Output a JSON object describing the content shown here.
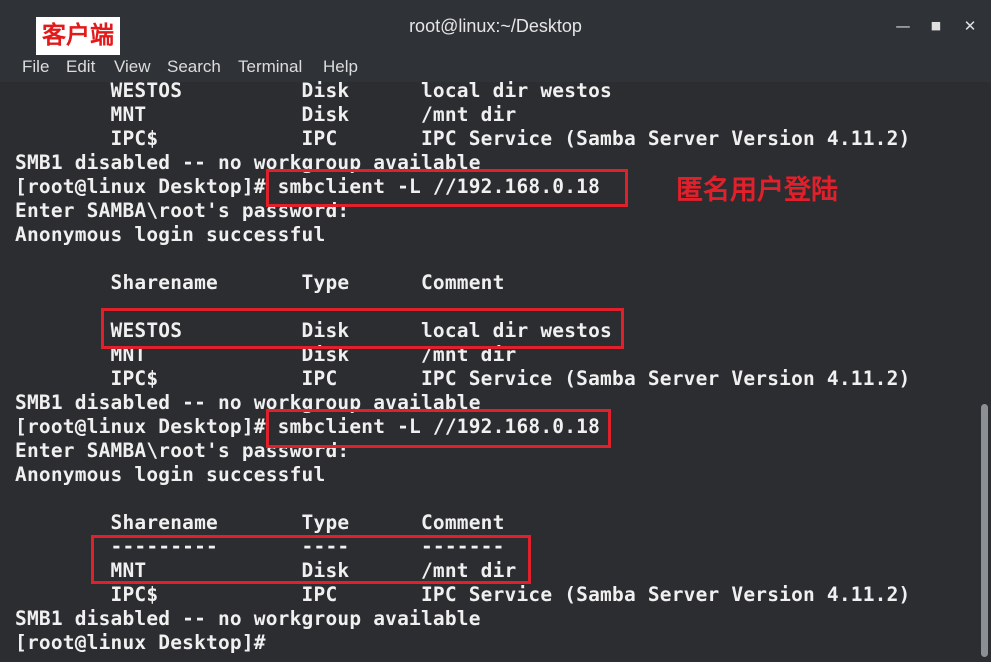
{
  "window": {
    "title": "root@linux:~/Desktop"
  },
  "menu": [
    "File",
    "Edit",
    "View",
    "Search",
    "Terminal",
    "Help"
  ],
  "annotations": {
    "client_label": "客户端",
    "anonymous_login_label": "匿名用户登陆"
  },
  "terminal_lines": [
    "        WESTOS          Disk      local dir westos",
    "        MNT             Disk      /mnt dir",
    "        IPC$            IPC       IPC Service (Samba Server Version 4.11.2)",
    "SMB1 disabled -- no workgroup available",
    "[root@linux Desktop]# smbclient -L //192.168.0.18",
    "Enter SAMBA\\root's password:",
    "Anonymous login successful",
    "",
    "        Sharename       Type      Comment",
    "",
    "        WESTOS          Disk      local dir westos",
    "        MNT             Disk      /mnt dir",
    "        IPC$            IPC       IPC Service (Samba Server Version 4.11.2)",
    "SMB1 disabled -- no workgroup available",
    "[root@linux Desktop]# smbclient -L //192.168.0.18",
    "Enter SAMBA\\root's password:",
    "Anonymous login successful",
    "",
    "        Sharename       Type      Comment",
    "        ---------       ----      -------",
    "        MNT             Disk      /mnt dir",
    "        IPC$            IPC       IPC Service (Samba Server Version 4.11.2)",
    "SMB1 disabled -- no workgroup available",
    "[root@linux Desktop]#"
  ],
  "colors": {
    "terminal_bg": "#2b2d30",
    "text": "#f0f0f0",
    "highlight_red": "#e0202a",
    "titlebar": "#2f3237"
  },
  "icons": [
    "minimize-icon",
    "maximize-icon",
    "close-icon"
  ]
}
